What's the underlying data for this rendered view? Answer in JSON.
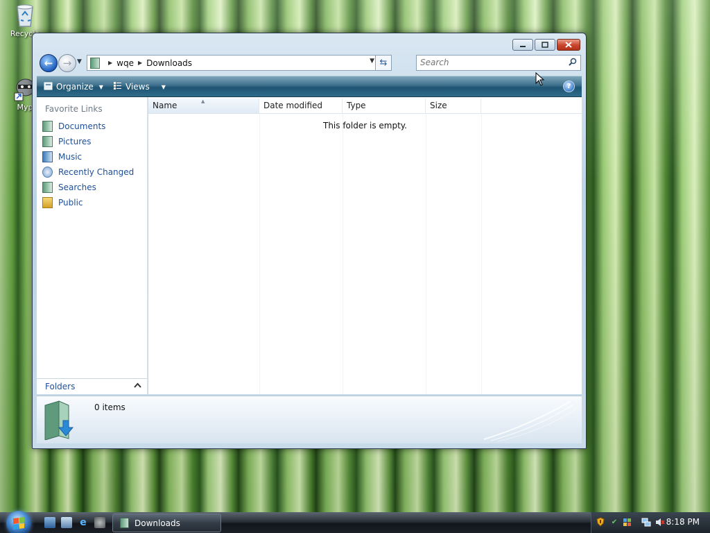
{
  "desktop": {
    "icons": [
      {
        "name": "recycle-bin",
        "label": "Recycle"
      },
      {
        "name": "shortcut",
        "label": "Myp"
      }
    ]
  },
  "window": {
    "address": {
      "crumbs": [
        "wqe",
        "Downloads"
      ]
    },
    "search": {
      "placeholder": "Search"
    },
    "command_bar": {
      "organize_label": "Organize",
      "views_label": "Views"
    },
    "nav_pane": {
      "heading": "Favorite Links",
      "items": [
        {
          "label": "Documents",
          "icon": "documents-icon"
        },
        {
          "label": "Pictures",
          "icon": "pictures-icon"
        },
        {
          "label": "Music",
          "icon": "music-icon"
        },
        {
          "label": "Recently Changed",
          "icon": "recently-changed-icon"
        },
        {
          "label": "Searches",
          "icon": "searches-icon"
        },
        {
          "label": "Public",
          "icon": "public-folder-icon"
        }
      ],
      "folders_label": "Folders"
    },
    "file_list": {
      "columns": [
        "Name",
        "Date modified",
        "Type",
        "Size"
      ],
      "sorted_column": "Name",
      "empty_message": "This folder is empty."
    },
    "details": {
      "items_count": "0 items"
    }
  },
  "taskbar": {
    "active_window_label": "Downloads",
    "clock": "8:18 PM"
  },
  "colors": {
    "link_blue": "#1e4f9a",
    "command_bar": "#2e6b8a",
    "close_red": "#c9442b"
  }
}
